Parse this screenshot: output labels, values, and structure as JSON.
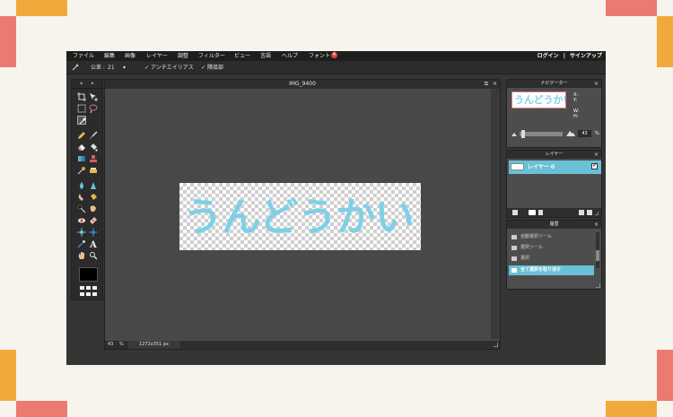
{
  "colors": {
    "deco_orange": "#f2a93b",
    "deco_red": "#ec7a70",
    "accent": "#6ac1d7",
    "image_text": "#7fd0e6"
  },
  "menubar": {
    "items": [
      "ファイル",
      "編集",
      "画像",
      "レイヤー",
      "調整",
      "フィルター",
      "ビュー",
      "言語",
      "ヘルプ",
      "フォント"
    ],
    "font_badge": "4",
    "login": "ログイン",
    "separator": "|",
    "signup": "サインアップ"
  },
  "options": {
    "tolerance_label": "公差 :",
    "tolerance_value": "21",
    "antialias_check": "✓",
    "antialias_label": "アンチエイリアス",
    "contiguous_check": "✓",
    "contiguous_label": "隣接部"
  },
  "document": {
    "title": "IMG_9400",
    "restore_icon": "⧉",
    "close_icon": "✕",
    "zoom": "43",
    "zoom_unit": "%",
    "dimensions": "1272x351 px",
    "image_text": "うんどうかい"
  },
  "navigator": {
    "title": "ナビゲーター",
    "close": "×",
    "thumb_text": "うんどうかい",
    "x_label": "X:",
    "y_label": "Y:",
    "w_label": "W:",
    "h_label": "H:",
    "zoom": "43",
    "zoom_unit": "%"
  },
  "layers": {
    "title": "レイヤー",
    "close": "×",
    "layer_name": "レイヤー 0",
    "check": "✓"
  },
  "history": {
    "title": "履歴",
    "close": "×",
    "items": [
      "自動選択ツール",
      "選択ツール",
      "選択",
      "全て選択を取り消す"
    ]
  }
}
